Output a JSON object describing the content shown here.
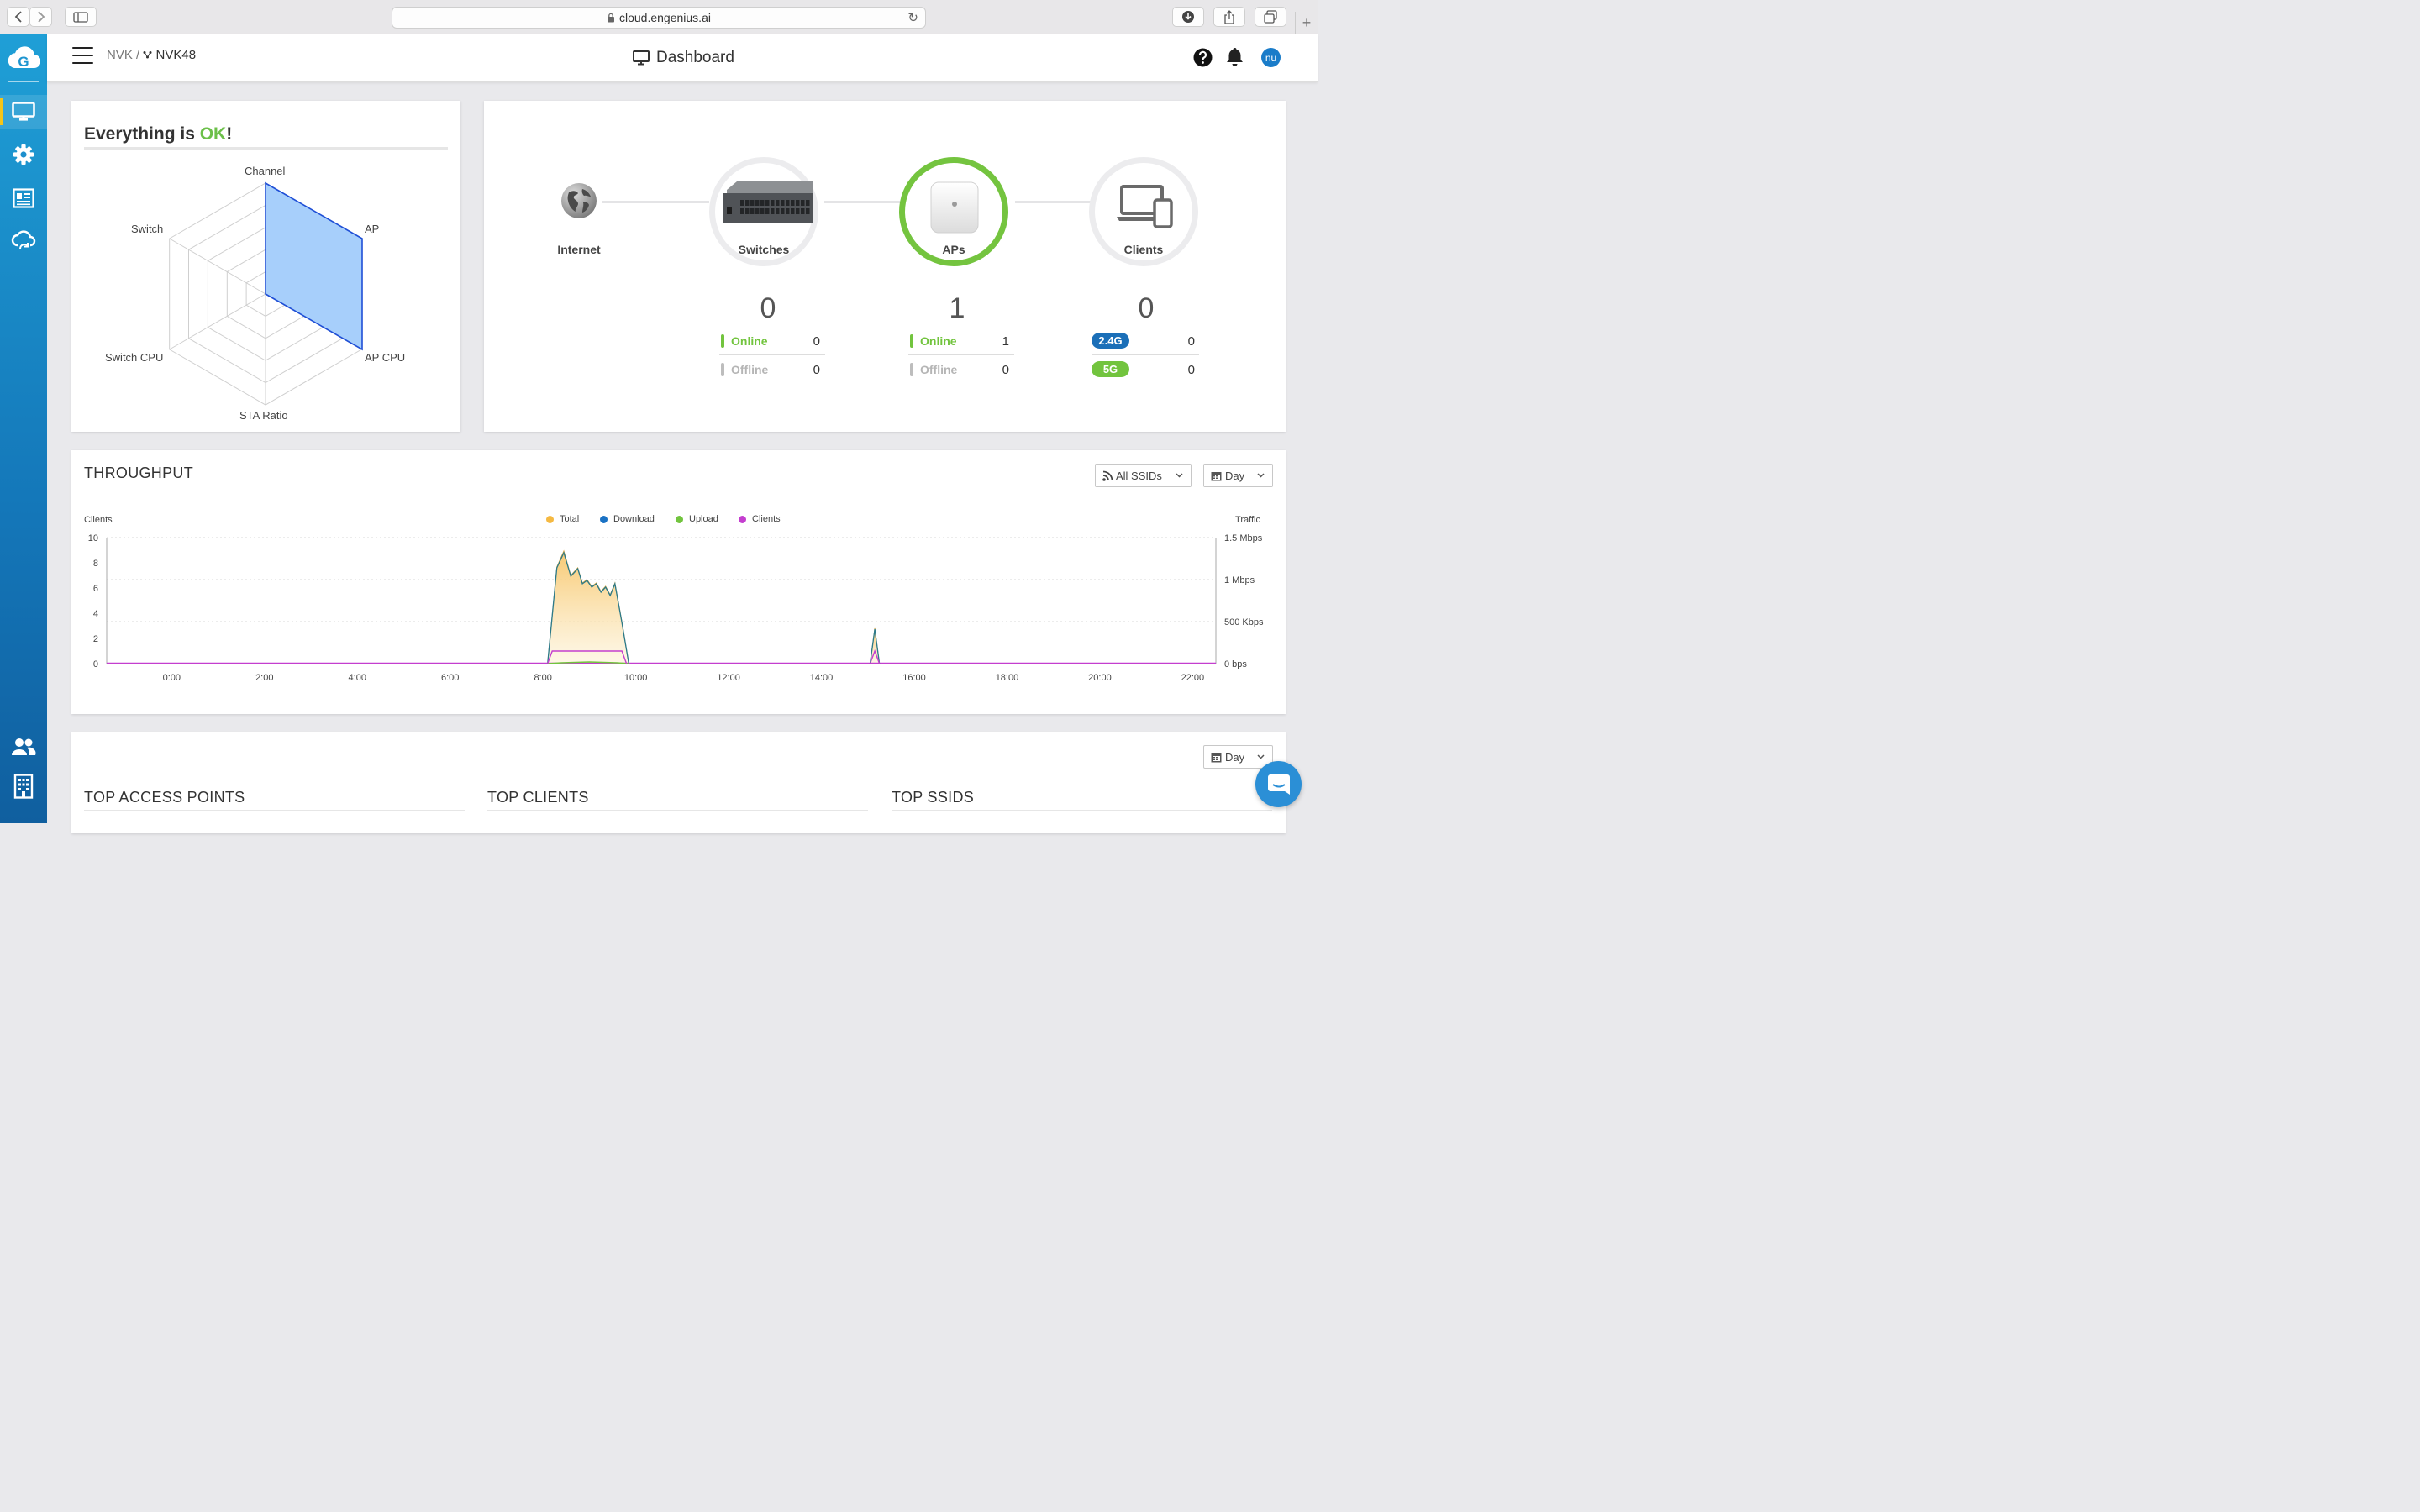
{
  "browser": {
    "url": "cloud.engenius.ai"
  },
  "header": {
    "breadcrumb_parent": "NVK",
    "breadcrumb_sep": "/",
    "breadcrumb_current": "NVK48",
    "title": "Dashboard",
    "avatar_initials": "nu"
  },
  "health": {
    "title_prefix": "Everything is ",
    "title_ok": "OK",
    "title_suffix": "!",
    "radar_axes": [
      "Channel",
      "AP",
      "AP CPU",
      "STA Ratio",
      "Switch CPU",
      "Switch"
    ]
  },
  "topology": {
    "internet_label": "Internet",
    "switches": {
      "label": "Switches",
      "count": "0",
      "online_label": "Online",
      "online": "0",
      "offline_label": "Offline",
      "offline": "0"
    },
    "aps": {
      "label": "APs",
      "count": "1",
      "online_label": "Online",
      "online": "1",
      "offline_label": "Offline",
      "offline": "0"
    },
    "clients": {
      "label": "Clients",
      "count": "0",
      "band_24_label": "2.4G",
      "band_24": "0",
      "band_5_label": "5G",
      "band_5": "0"
    }
  },
  "throughput": {
    "title": "THROUGHPUT",
    "ssid_filter": "All SSIDs",
    "range_filter": "Day"
  },
  "tops": {
    "range_filter": "Day",
    "access_points_title": "TOP ACCESS POINTS",
    "clients_title": "TOP CLIENTS",
    "ssids_title": "TOP SSIDS"
  },
  "colors": {
    "ok_green": "#6cc04a",
    "total": "#f5b942",
    "download": "#1a72c4",
    "upload": "#72c43e",
    "clients": "#c43ecf",
    "band_24": "#1b6fb8",
    "band_5": "#72c43e",
    "offline_gray": "#bdbdbd"
  },
  "chart_data": {
    "type": "area",
    "title": "",
    "left_axis_label": "Clients",
    "right_axis_label": "Traffic",
    "left_ticks": [
      "10",
      "8",
      "6",
      "4",
      "2",
      "0"
    ],
    "right_ticks": [
      "1.5 Mbps",
      "1 Mbps",
      "500 Kbps",
      "0 bps"
    ],
    "x_ticks": [
      "0:00",
      "2:00",
      "4:00",
      "6:00",
      "8:00",
      "10:00",
      "12:00",
      "14:00",
      "16:00",
      "18:00",
      "20:00",
      "22:00"
    ],
    "ylim_clients": [
      0,
      10
    ],
    "ylim_traffic_kbps": [
      0,
      1500
    ],
    "series": [
      {
        "name": "Total",
        "unit": "Kbps",
        "x": [
          8.1,
          8.3,
          8.45,
          8.6,
          8.75,
          8.85,
          8.95,
          9.05,
          9.15,
          9.25,
          9.35,
          9.45,
          9.55,
          9.7,
          9.85,
          15.05,
          15.15,
          15.25
        ],
        "y": [
          0,
          1150,
          1340,
          1050,
          1140,
          960,
          1000,
          920,
          960,
          860,
          920,
          820,
          960,
          500,
          0,
          0,
          420,
          0
        ]
      },
      {
        "name": "Download",
        "unit": "Kbps",
        "x": [
          8.1,
          8.3,
          8.45,
          8.6,
          8.75,
          8.85,
          8.95,
          9.05,
          9.15,
          9.25,
          9.35,
          9.45,
          9.55,
          9.7,
          9.85,
          15.05,
          15.15,
          15.25
        ],
        "y": [
          0,
          1140,
          1320,
          1040,
          1130,
          950,
          990,
          910,
          950,
          850,
          910,
          810,
          950,
          490,
          0,
          0,
          410,
          0
        ]
      },
      {
        "name": "Upload",
        "unit": "Kbps",
        "x": [
          8.1,
          8.4,
          9.0,
          9.6,
          9.85
        ],
        "y": [
          0,
          10,
          20,
          10,
          0
        ]
      },
      {
        "name": "Clients",
        "unit": "count",
        "x": [
          8.1,
          8.2,
          9.7,
          9.8,
          15.05,
          15.15,
          15.25
        ],
        "y": [
          0,
          1,
          1,
          0,
          0,
          1,
          0
        ]
      }
    ]
  }
}
